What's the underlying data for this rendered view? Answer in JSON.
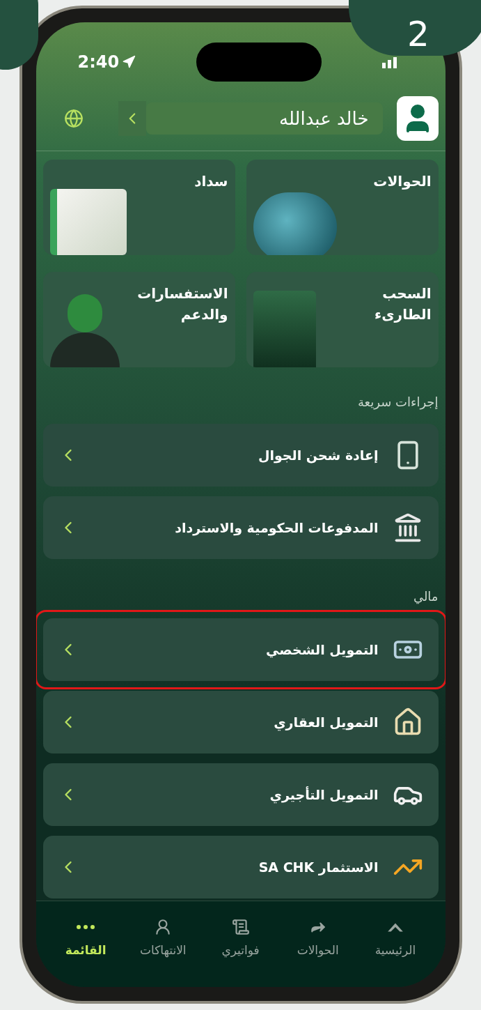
{
  "step_badge": "2",
  "status_bar": {
    "time": "2:40"
  },
  "header": {
    "user_name": "خالد عبدالله"
  },
  "tiles": [
    {
      "label": "الحوالات",
      "kind": "globe"
    },
    {
      "label": "سداد",
      "kind": "folders"
    },
    {
      "label": "السحب الطارىء",
      "kind": "atm"
    },
    {
      "label": "الاستفسارات والدعم",
      "kind": "agent"
    }
  ],
  "sections": [
    {
      "title": "إجراءات سريعة",
      "items": [
        {
          "label": "إعادة شحن الجوال",
          "kind": "phone",
          "highlighted": false
        },
        {
          "label": "المدفوعات الحكومية والاسترداد",
          "kind": "bank",
          "highlighted": false
        }
      ]
    },
    {
      "title": "مالي",
      "items": [
        {
          "label": "التمويل الشخصي",
          "kind": "money",
          "highlighted": true
        },
        {
          "label": "التمويل العقاري",
          "kind": "house",
          "highlighted": false
        },
        {
          "label": "التمويل التأجيري",
          "kind": "car",
          "highlighted": false
        },
        {
          "label": "الاستثمار SA CHK",
          "kind": "chart",
          "highlighted": false
        }
      ]
    }
  ],
  "tab_bar": [
    {
      "label": "الرئيسية",
      "kind": "home",
      "selected": false
    },
    {
      "label": "الحوالات",
      "kind": "transfer",
      "selected": false
    },
    {
      "label": "فواتيري",
      "kind": "bills",
      "selected": false
    },
    {
      "label": "الانتهاكات",
      "kind": "officer",
      "selected": false
    },
    {
      "label": "القائمة",
      "kind": "more",
      "selected": true
    }
  ]
}
